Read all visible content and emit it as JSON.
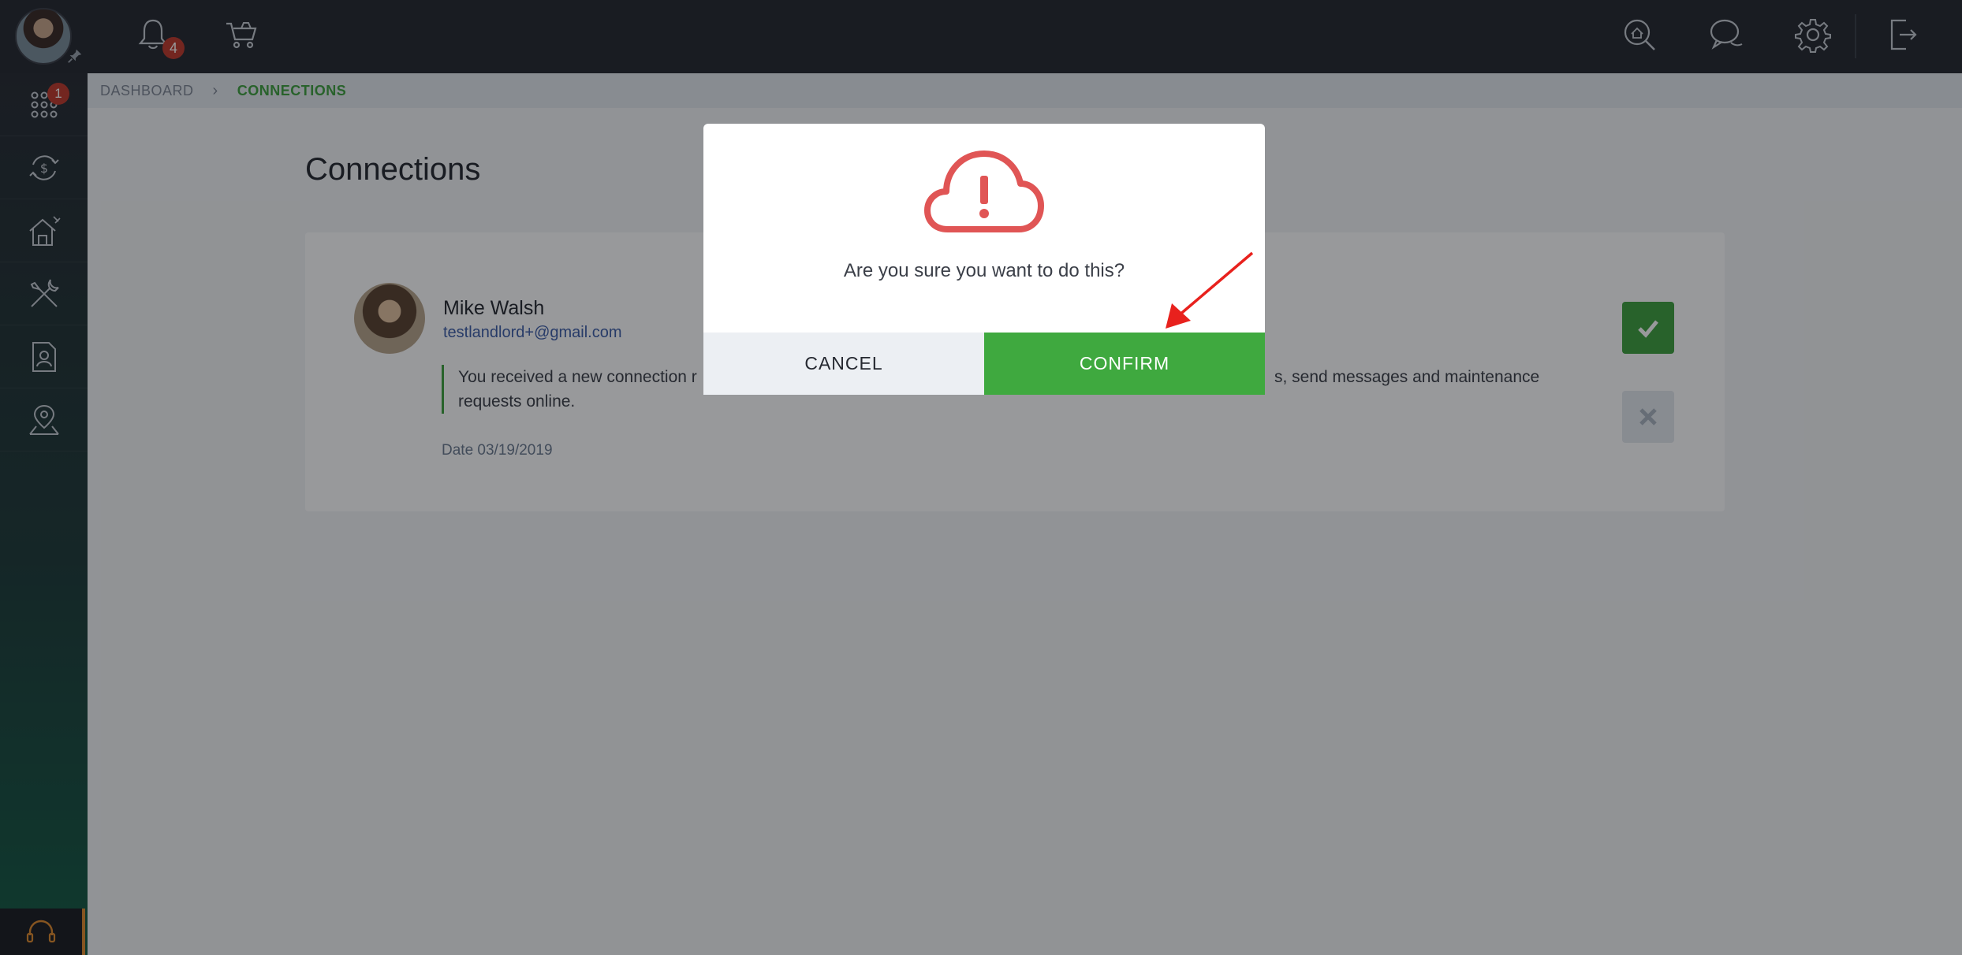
{
  "topbar": {
    "notification_count": "4",
    "icons": [
      "notifications-bell-icon",
      "cart-icon",
      "home-search-icon",
      "chat-icon",
      "settings-gear-icon",
      "logout-icon"
    ]
  },
  "sidebar": {
    "apps_badge": "1",
    "items": [
      "apps-grid-icon",
      "payments-icon",
      "property-icon",
      "maintenance-tools-icon",
      "tenant-profile-icon",
      "location-icon"
    ],
    "support_icon": "headset-icon"
  },
  "breadcrumb": {
    "home": "DASHBOARD",
    "current": "CONNECTIONS"
  },
  "page": {
    "title": "Connections"
  },
  "connection": {
    "name": "Mike Walsh",
    "email": "testlandlord+@gmail.com",
    "message_start": "You received a new connection r",
    "message_end": "s, send messages and maintenance",
    "message_line2": "requests online.",
    "date": "Date 03/19/2019"
  },
  "modal": {
    "question": "Are you sure you want to do this?",
    "cancel_label": "CANCEL",
    "confirm_label": "CONFIRM"
  },
  "colors": {
    "accent_green": "#3fa93f",
    "alert_red": "#e05555",
    "topbar": "#252830"
  }
}
